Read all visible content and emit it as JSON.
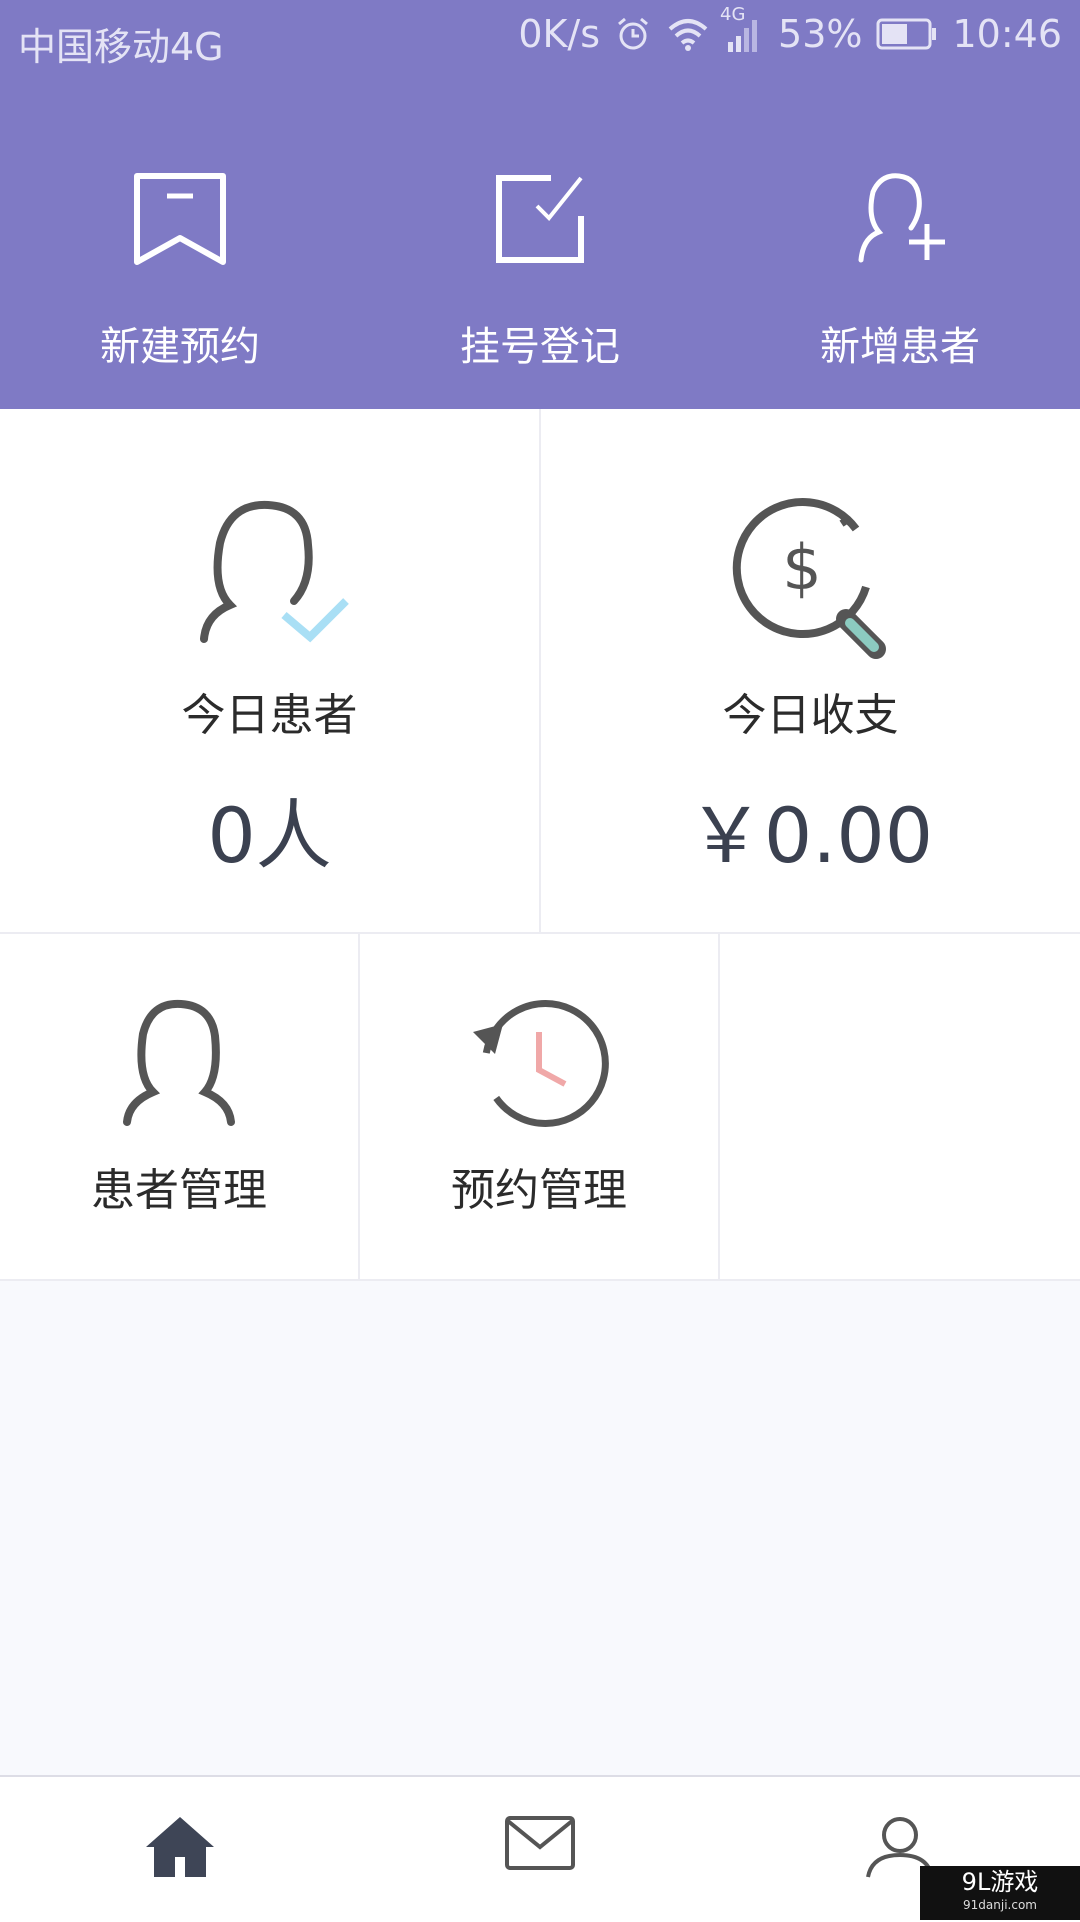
{
  "status_bar": {
    "carrier": "中国移动4G",
    "speed": "0K/s",
    "network": "4G",
    "battery": "53%",
    "time": "10:46"
  },
  "quick_actions": [
    {
      "label": "新建预约",
      "icon": "bookmark-icon"
    },
    {
      "label": "挂号登记",
      "icon": "checkbox-icon"
    },
    {
      "label": "新增患者",
      "icon": "add-user-icon"
    }
  ],
  "stats": {
    "patients_today": {
      "title": "今日患者",
      "value": "0人"
    },
    "income_today": {
      "title": "今日收支",
      "value": "￥0.00"
    }
  },
  "menu": [
    {
      "label": "患者管理",
      "icon": "patient-icon"
    },
    {
      "label": "预约管理",
      "icon": "history-clock-icon"
    }
  ],
  "tabbar": [
    {
      "icon": "home-icon",
      "active": true
    },
    {
      "icon": "mail-icon",
      "active": false
    },
    {
      "icon": "profile-icon",
      "active": false
    }
  ],
  "colors": {
    "header": "#7f7ac5",
    "check_accent": "#a9dff5",
    "magnifier_handle": "#8ccbc0",
    "clock_hand": "#f0a8a8"
  },
  "watermark": {
    "brand": "9L游戏",
    "domain": "91danji.com"
  }
}
